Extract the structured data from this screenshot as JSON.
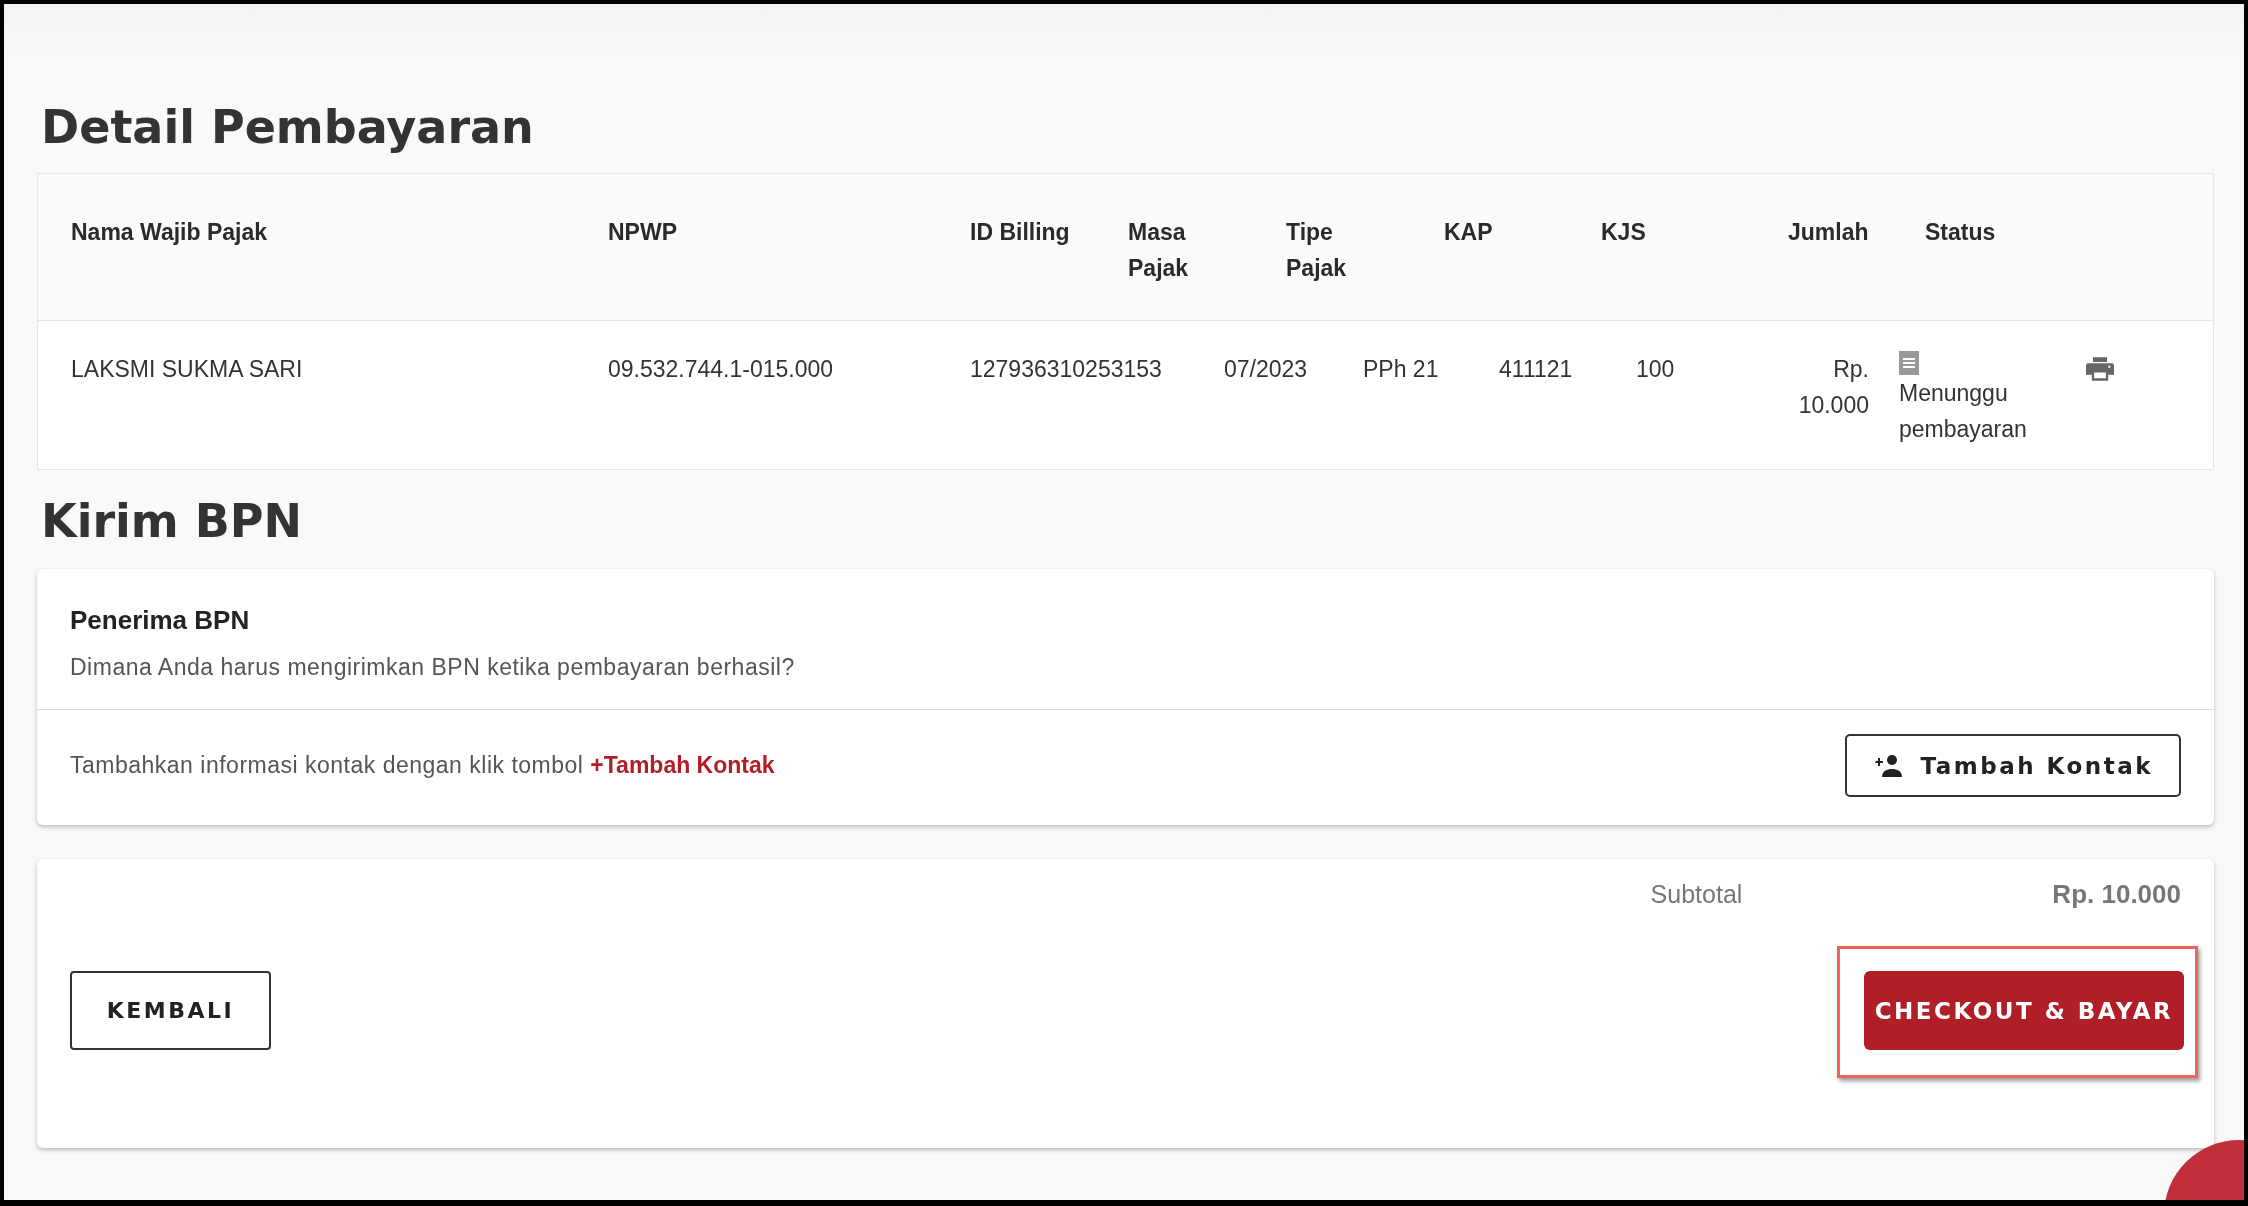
{
  "payment_detail": {
    "title": "Detail Pembayaran",
    "table": {
      "columns": [
        "Nama Wajib Pajak",
        "NPWP",
        "ID Billing",
        "Masa Pajak",
        "Tipe Pajak",
        "KAP",
        "KJS",
        "Jumlah",
        "Status"
      ],
      "rows": [
        {
          "name": "LAKSMI SUKMA SARI",
          "npwp": "09.532.744.1-015.000",
          "id_billing": "127936310253153",
          "masa_pajak": "07/2023",
          "tipe_pajak": "PPh 21",
          "kap": "411121",
          "kjs": "100",
          "jumlah": "Rp. 10.000",
          "status": "Menunggu pembayaran"
        }
      ]
    }
  },
  "send_bpn": {
    "title": "Kirim BPN",
    "card_title": "Penerima BPN",
    "question": "Dimana Anda harus mengirimkan BPN ketika pembayaran berhasil?",
    "hint": "Tambahkan informasi kontak dengan klik tombol",
    "hint_link": "+Tambah Kontak",
    "add_button": "Tambah Kontak"
  },
  "summary": {
    "subtotal_label": "Subtotal",
    "subtotal_value": "Rp. 10.000",
    "back_button": "KEMBALI",
    "checkout_button": "CHECKOUT & BAYAR",
    "checkout_highlighted": true
  }
}
